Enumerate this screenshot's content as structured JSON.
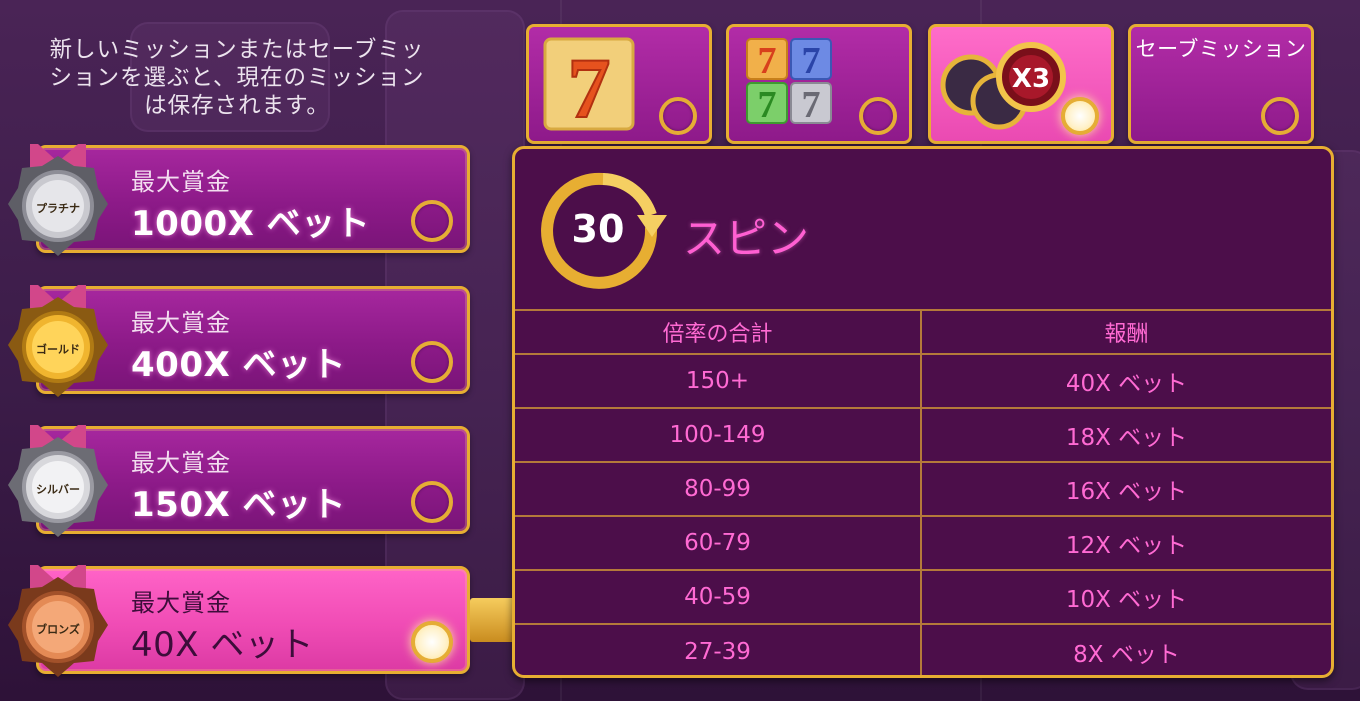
{
  "intro": "新しいミッションまたはセーブミッションを選ぶと、現在のミッションは保存されます。",
  "missions": [
    {
      "medal": "プラチナ",
      "caption": "最大賞金",
      "value": "1000X ベット"
    },
    {
      "medal": "ゴールド",
      "caption": "最大賞金",
      "value": "400X ベット"
    },
    {
      "medal": "シルバー",
      "caption": "最大賞金",
      "value": "150X ベット"
    },
    {
      "medal": "ブロンズ",
      "caption": "最大賞金",
      "value": "40X ベット"
    }
  ],
  "tabs": {
    "saved_label": "セーブミッション"
  },
  "seven_tab": {
    "digit": "7"
  },
  "multi_tab": {
    "digits": [
      "7",
      "7",
      "7",
      "7"
    ]
  },
  "bonus_tab": {
    "badge": "X3"
  },
  "spin": {
    "count": "30",
    "label": "スピン"
  },
  "table": {
    "headers": [
      "倍率の合計",
      "報酬"
    ],
    "rows": [
      [
        "150+",
        "40X ベット"
      ],
      [
        "100-149",
        "18X ベット"
      ],
      [
        "80-99",
        "16X ベット"
      ],
      [
        "60-79",
        "12X ベット"
      ],
      [
        "40-59",
        "10X ベット"
      ],
      [
        "27-39",
        "8X ベット"
      ]
    ]
  },
  "colors": {
    "gold_border": "#e7ae32",
    "purple_card": "#8c1a88",
    "pink_active": "#f04cb5",
    "table_text": "#ff6ad3",
    "panel_bg": "#4c0e4a"
  }
}
